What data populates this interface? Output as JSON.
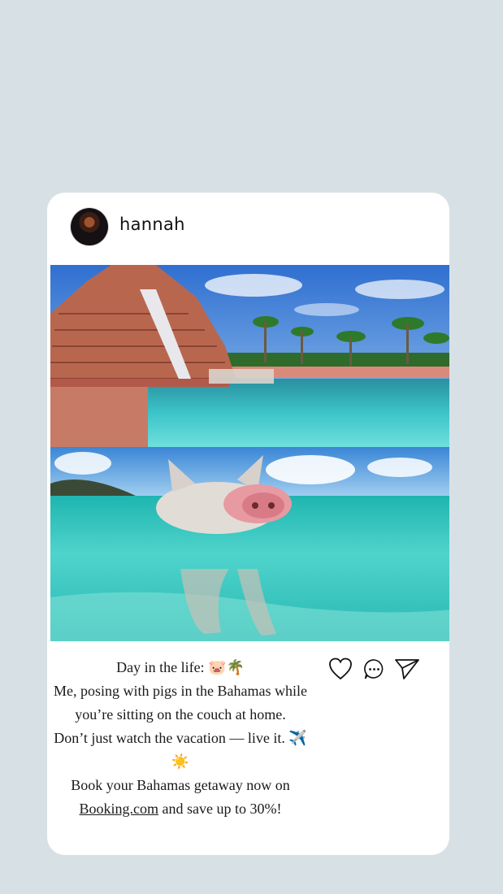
{
  "post": {
    "username": "hannah",
    "caption_lines": [
      "Day in the life: 🐷🌴",
      "Me, posing with pigs in the Bahamas while",
      "you’re sitting on the couch at home.",
      "Don’t just watch the vacation — live it. ✈️",
      "☀️",
      "Book your Bahamas getaway now on"
    ],
    "caption_link": "Booking.com",
    "caption_after_link": " and save up to 30%!"
  },
  "icons": {
    "like": "heart-icon",
    "comment": "comment-icon",
    "share": "send-icon"
  },
  "colors": {
    "background": "#d7e1e5",
    "card": "#ffffff",
    "text": "#1a1a1a",
    "water": "#3fc8c4",
    "sky": "#3f7fd0"
  }
}
